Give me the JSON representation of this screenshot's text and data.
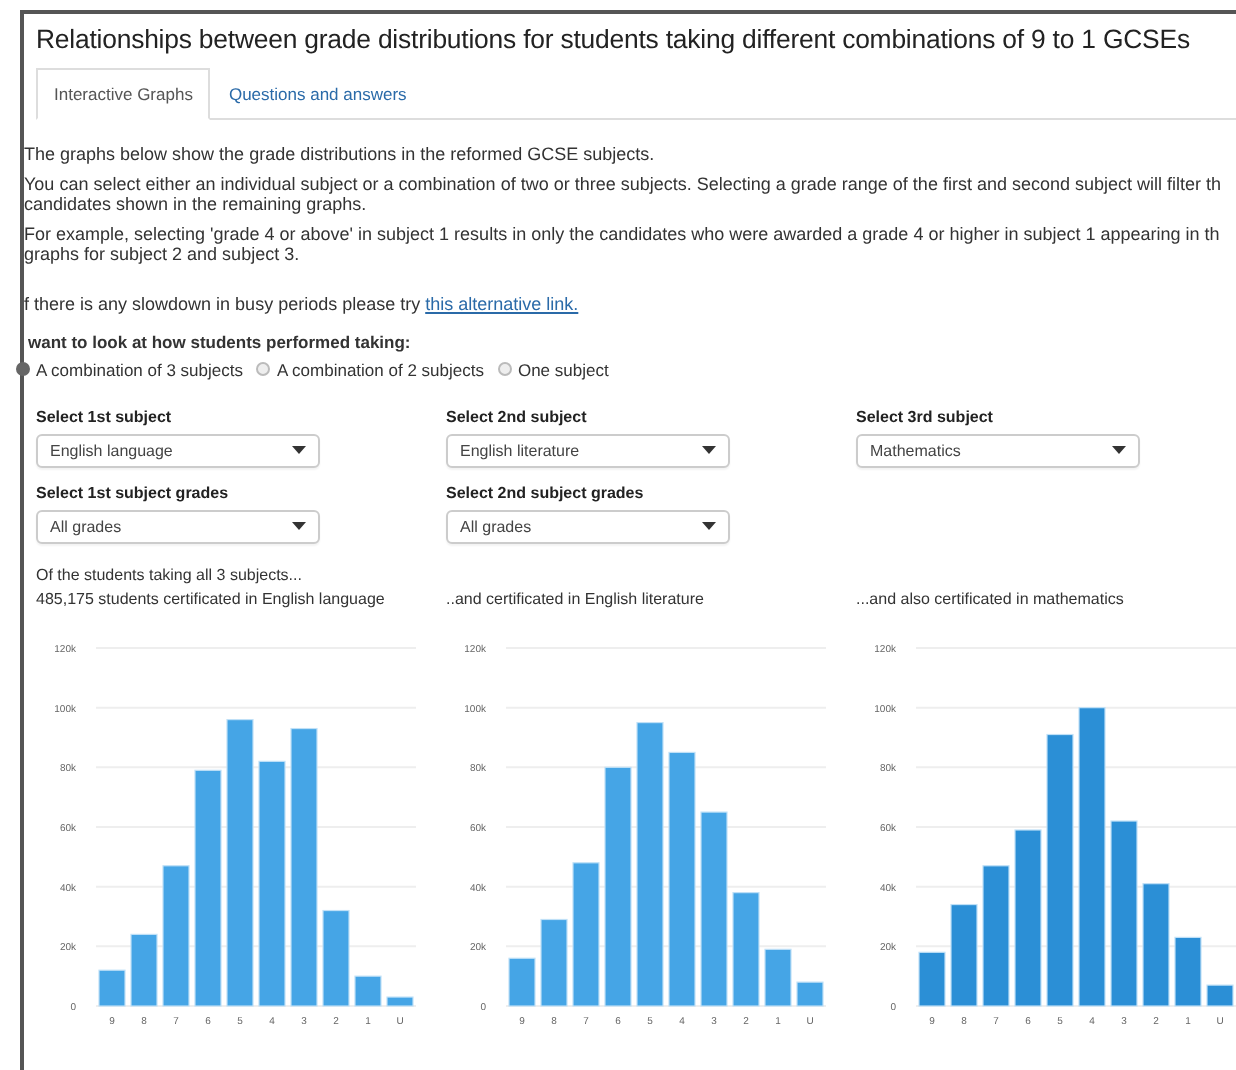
{
  "title": "Relationships between grade distributions for students taking different combinations of 9 to 1 GCSEs",
  "tabs": [
    {
      "label": "Interactive Graphs",
      "selected": true
    },
    {
      "label": "Questions and answers",
      "selected": false
    }
  ],
  "paragraphs": [
    {
      "lines": [
        "The graphs below show the grade distributions in the reformed GCSE subjects."
      ]
    },
    {
      "lines": [
        "You can select either an individual subject or a combination of two or three subjects. Selecting a grade range of the first and second subject will filter th",
        "candidates shown in the remaining graphs."
      ]
    },
    {
      "lines": [
        "For example, selecting 'grade 4 or above' in subject 1 results in only the candidates who were awarded a grade 4 or higher in subject 1 appearing in th",
        "graphs for subject 2 and subject 3."
      ]
    }
  ],
  "slowdown": {
    "text": "f there is any slowdown in busy periods please try ",
    "link": "this alternative link."
  },
  "question": "want to look at how students performed taking:",
  "options": [
    {
      "label": "A combination of 3 subjects",
      "selected": true
    },
    {
      "label": "A combination of 2 subjects",
      "selected": false
    },
    {
      "label": "One subject",
      "selected": false
    }
  ],
  "subject_selects": [
    {
      "label": "Select 1st subject",
      "value": "English language"
    },
    {
      "label": "Select 2nd subject",
      "value": "English literature"
    },
    {
      "label": "Select 3rd subject",
      "value": "Mathematics"
    }
  ],
  "grade_selects": [
    {
      "label": "Select 1st subject grades",
      "value": "All grades"
    },
    {
      "label": "Select 2nd subject grades",
      "value": "All grades"
    }
  ],
  "intro": "Of the students taking all 3 subjects...",
  "charts": [
    {
      "caption": "485,175 students certificated in English language",
      "chart_data": {
        "type": "bar",
        "categories": [
          "9",
          "8",
          "7",
          "6",
          "5",
          "4",
          "3",
          "2",
          "1",
          "U"
        ],
        "grid": true,
        "series": [
          {
            "color": "#45a5e6",
            "values": [
              12000,
              24000,
              47000,
              79000,
              96000,
              82000,
              93000,
              32000,
              10000,
              3000
            ]
          }
        ],
        "ylim": [
          0,
          120000
        ],
        "yticks": [
          {
            "value": 0,
            "label": "0"
          },
          {
            "value": 20000,
            "label": "20k"
          },
          {
            "value": 40000,
            "label": "40k"
          },
          {
            "value": 60000,
            "label": "60k"
          },
          {
            "value": 80000,
            "label": "80k"
          },
          {
            "value": 100000,
            "label": "100k"
          },
          {
            "value": 120000,
            "label": "120k"
          }
        ]
      }
    },
    {
      "caption": "..and certificated in English literature",
      "chart_data": {
        "type": "bar",
        "categories": [
          "9",
          "8",
          "7",
          "6",
          "5",
          "4",
          "3",
          "2",
          "1",
          "U"
        ],
        "grid": true,
        "series": [
          {
            "color": "#45a5e6",
            "values": [
              16000,
              29000,
              48000,
              80000,
              95000,
              85000,
              65000,
              38000,
              19000,
              8000
            ]
          }
        ],
        "ylim": [
          0,
          120000
        ],
        "yticks": [
          {
            "value": 0,
            "label": "0"
          },
          {
            "value": 20000,
            "label": "20k"
          },
          {
            "value": 40000,
            "label": "40k"
          },
          {
            "value": 60000,
            "label": "60k"
          },
          {
            "value": 80000,
            "label": "80k"
          },
          {
            "value": 100000,
            "label": "100k"
          },
          {
            "value": 120000,
            "label": "120k"
          }
        ]
      }
    },
    {
      "caption": "...and also certificated in mathematics",
      "chart_data": {
        "type": "bar",
        "categories": [
          "9",
          "8",
          "7",
          "6",
          "5",
          "4",
          "3",
          "2",
          "1",
          "U"
        ],
        "grid": true,
        "series": [
          {
            "color": "#2b8fd6",
            "values": [
              18000,
              34000,
              47000,
              59000,
              91000,
              100000,
              62000,
              41000,
              23000,
              7000
            ]
          }
        ],
        "ylim": [
          0,
          120000
        ],
        "yticks": [
          {
            "value": 0,
            "label": "0"
          },
          {
            "value": 20000,
            "label": "20k"
          },
          {
            "value": 40000,
            "label": "40k"
          },
          {
            "value": 60000,
            "label": "60k"
          },
          {
            "value": 80000,
            "label": "80k"
          },
          {
            "value": 100000,
            "label": "100k"
          },
          {
            "value": 120000,
            "label": "120k"
          }
        ]
      }
    }
  ]
}
